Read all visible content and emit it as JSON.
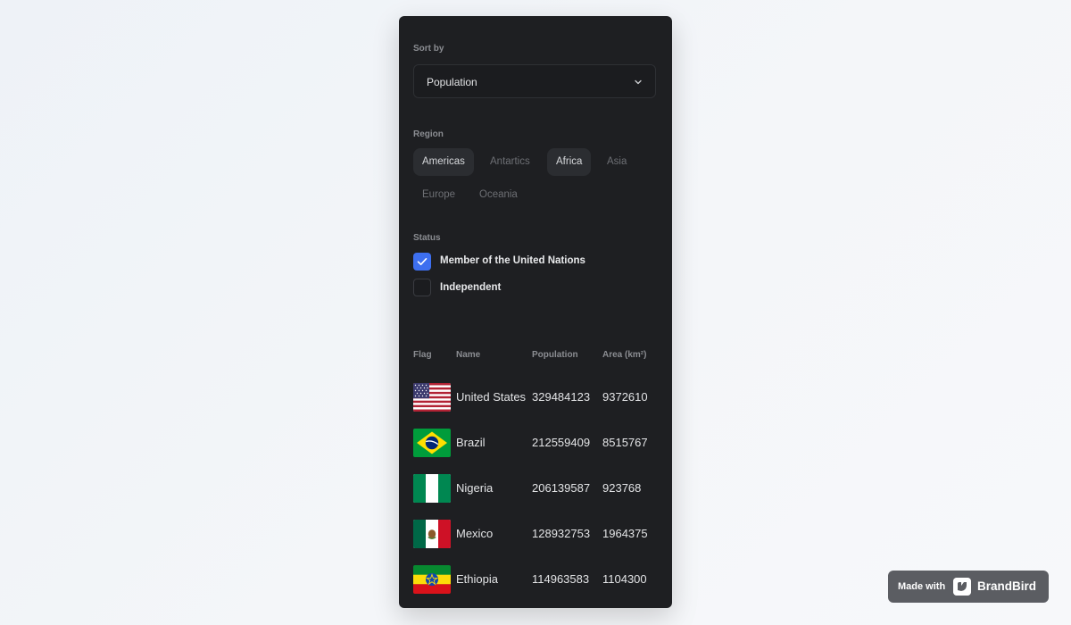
{
  "sort": {
    "label": "Sort by",
    "value": "Population"
  },
  "region": {
    "label": "Region",
    "chips": [
      {
        "label": "Americas",
        "active": true
      },
      {
        "label": "Antartics",
        "active": false
      },
      {
        "label": "Africa",
        "active": true
      },
      {
        "label": "Asia",
        "active": false
      },
      {
        "label": "Europe",
        "active": false
      },
      {
        "label": "Oceania",
        "active": false
      }
    ]
  },
  "status": {
    "label": "Status",
    "options": [
      {
        "label": "Member of the United Nations",
        "checked": true
      },
      {
        "label": "Independent",
        "checked": false
      }
    ]
  },
  "table": {
    "headers": [
      "Flag",
      "Name",
      "Population",
      "Area (km²)"
    ],
    "rows": [
      {
        "flag": "us-flag-icon",
        "name": "United States",
        "population": "329484123",
        "area": "9372610"
      },
      {
        "flag": "brazil-flag-icon",
        "name": "Brazil",
        "population": "212559409",
        "area": "8515767"
      },
      {
        "flag": "nigeria-flag-icon",
        "name": "Nigeria",
        "population": "206139587",
        "area": "923768"
      },
      {
        "flag": "mexico-flag-icon",
        "name": "Mexico",
        "population": "128932753",
        "area": "1964375"
      },
      {
        "flag": "ethiopia-flag-icon",
        "name": "Ethiopia",
        "population": "114963583",
        "area": "1104300"
      }
    ]
  },
  "badge": {
    "made_with": "Made with",
    "brand": "BrandBird"
  },
  "colors": {
    "accent": "#3d6ff0",
    "panel_bg": "#1e1f22"
  }
}
